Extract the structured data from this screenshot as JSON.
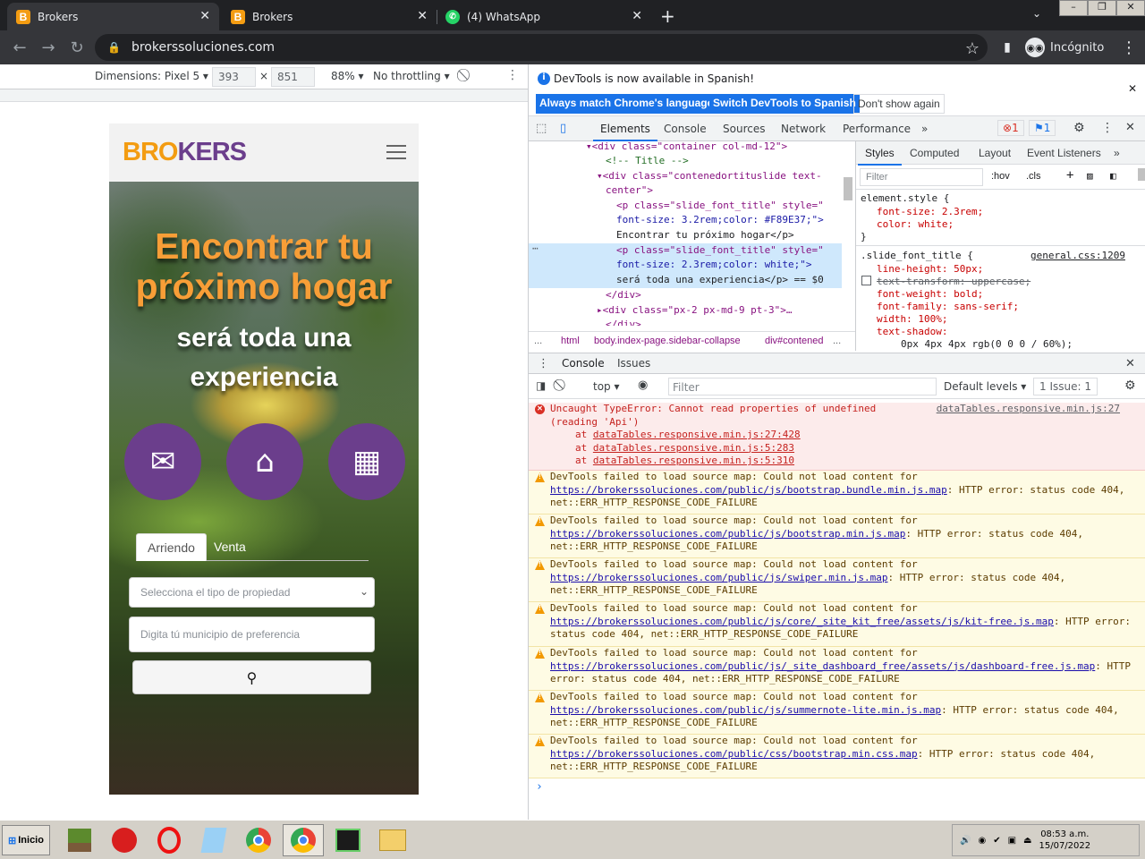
{
  "browser": {
    "tabs": [
      {
        "title": "Brokers",
        "favicon": "B",
        "active": true
      },
      {
        "title": "Brokers",
        "favicon": "B",
        "active": false
      },
      {
        "title": "(4) WhatsApp",
        "favicon": "WA",
        "active": false
      }
    ],
    "new_tab_label": "+",
    "url": "brokerssoluciones.com",
    "profile_label": "Incógnito",
    "window_controls": [
      "minimize",
      "maximize",
      "close"
    ]
  },
  "device_toolbar": {
    "dimensions_label": "Dimensions: Pixel 5 ▾",
    "width": "393",
    "height": "851",
    "times": "×",
    "zoom": "88% ▾",
    "throttling": "No throttling ▾"
  },
  "mobile_page": {
    "logo_orange": "BRO",
    "logo_purple": "KERS",
    "headline_line1": "Encontrar tu",
    "headline_line2": "próximo hogar",
    "subline_line1": "será toda una",
    "subline_line2": "experiencia",
    "feature_icons": [
      "envelope-megaphone-icon",
      "house-hand-icon",
      "building-crane-icon"
    ],
    "tabs": [
      "Arriendo",
      "Venta"
    ],
    "property_select_placeholder": "Selecciona el tipo de propiedad",
    "municipio_placeholder": "Digita tú municipio de preferencia",
    "search_icon": "🔍",
    "colors": {
      "orange": "#F89E37",
      "purple": "#6b3e8c"
    }
  },
  "devtools": {
    "banner_text": "DevTools is now available in Spanish!",
    "banner_buttons": [
      "Always match Chrome's language",
      "Switch DevTools to Spanish",
      "Don't show again"
    ],
    "tabs": [
      "Elements",
      "Console",
      "Sources",
      "Network",
      "Performance",
      "»"
    ],
    "error_count": "1",
    "issue_count": "1",
    "elements_lines": [
      "▾<div class=\"container col-md-12\">",
      "<!-- Title -->",
      "▾<div class=\"contenedortituslide text-",
      "center\">",
      "<p class=\"slide_font_title\" style=\"",
      "font-size: 3.2rem;color: #F89E37;\">",
      "Encontrar tu próximo hogar</p>",
      "<p class=\"slide_font_title\" style=\"",
      "font-size: 2.3rem;color: white;\">",
      "será toda una experiencia</p> == $0",
      "</div>",
      "▸<div class=\"px-2 px-md-9 pt-3\">…",
      "</div>"
    ],
    "breadcrumbs": [
      "...",
      "html",
      "body.index-page.sidebar-collapse",
      "div#contened",
      "..."
    ],
    "styles_tabs": [
      "Styles",
      "Computed",
      "Layout",
      "Event Listeners",
      "»"
    ],
    "styles_filter_placeholder": "Filter",
    "styles_hov": ":hov",
    "styles_cls": ".cls",
    "styles_lines": [
      "element.style {",
      "font-size: 2.3rem;",
      "color: white;",
      "}",
      ".slide_font_title {",
      "general.css:1209",
      "line-height: 50px;",
      "text-transform: uppercase;",
      "font-weight: bold;",
      "font-family: sans-serif;",
      "width: 100%;",
      "text-shadow:",
      "0px 4px 4px rgb(0 0 0 / 60%);"
    ],
    "drawer_tabs": [
      "Console",
      "Issues"
    ],
    "console_context": "top ▾",
    "console_filter_placeholder": "Filter",
    "default_levels": "Default levels ▾",
    "issues_badge": "1 Issue: 1",
    "messages": [
      {
        "level": "error",
        "text": "Uncaught TypeError: Cannot read properties of undefined\n(reading 'Api')",
        "source": "dataTables.responsive.min.js:27",
        "stack": [
          "dataTables.responsive.min.js:27:428",
          "dataTables.responsive.min.js:5:283",
          "dataTables.responsive.min.js:5:310"
        ]
      },
      {
        "level": "warning",
        "pre": "DevTools failed to load source map: Could not load content for ",
        "url": "https://brokerssoluciones.com/public/js/bootstrap.bundle.min.js.map",
        "post": ": HTTP error: status code 404, net::ERR_HTTP_RESPONSE_CODE_FAILURE"
      },
      {
        "level": "warning",
        "pre": "DevTools failed to load source map: Could not load content for ",
        "url": "https://brokerssoluciones.com/public/js/bootstrap.min.js.map",
        "post": ": HTTP error: status code 404, net::ERR_HTTP_RESPONSE_CODE_FAILURE"
      },
      {
        "level": "warning",
        "pre": "DevTools failed to load source map: Could not load content for ",
        "url": "https://brokerssoluciones.com/public/js/swiper.min.js.map",
        "post": ": HTTP error: status code 404, net::ERR_HTTP_RESPONSE_CODE_FAILURE"
      },
      {
        "level": "warning",
        "pre": "DevTools failed to load source map: Could not load content for ",
        "url": "https://brokerssoluciones.com/public/js/core/_site_kit_free/assets/js/kit-free.js.map",
        "post": ": HTTP error: status code 404, net::ERR_HTTP_RESPONSE_CODE_FAILURE"
      },
      {
        "level": "warning",
        "pre": "DevTools failed to load source map: Could not load content for ",
        "url": "https://brokerssoluciones.com/public/js/_site_dashboard_free/assets/js/dashboard-free.js.map",
        "post": ": HTTP error: status code 404, net::ERR_HTTP_RESPONSE_CODE_FAILURE"
      },
      {
        "level": "warning",
        "pre": "DevTools failed to load source map: Could not load content for ",
        "url": "https://brokerssoluciones.com/public/js/summernote-lite.min.js.map",
        "post": ": HTTP error: status code 404, net::ERR_HTTP_RESPONSE_CODE_FAILURE"
      },
      {
        "level": "warning",
        "pre": "DevTools failed to load source map: Could not load content for ",
        "url": "https://brokerssoluciones.com/public/css/bootstrap.min.css.map",
        "post": ": HTTP error: status code 404, net::ERR_HTTP_RESPONSE_CODE_FAILURE"
      }
    ],
    "prompt": "›"
  },
  "taskbar": {
    "start_label": "Inicio",
    "apps": [
      "minecraft-icon",
      "antivirus-icon",
      "opera-icon",
      "notepad-icon",
      "chrome-icon",
      "chrome-profile-icon",
      "task-manager-icon",
      "explorer-icon"
    ],
    "time": "08:53 a.m.",
    "date": "15/07/2022"
  }
}
